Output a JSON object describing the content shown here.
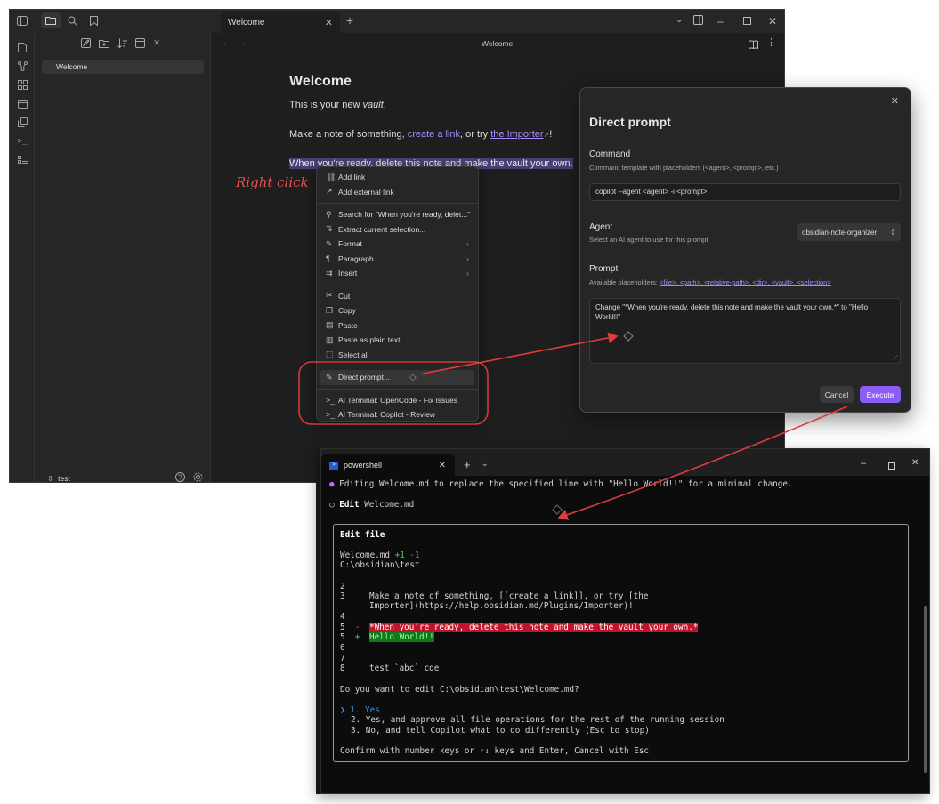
{
  "obsidian": {
    "tab_title": "Welcome",
    "view_title": "Welcome",
    "sidebar_file": "Welcome",
    "vault_name": "test",
    "note": {
      "heading": "Welcome",
      "line1_pre": "This is your new ",
      "line1_em": "vault",
      "line1_post": ".",
      "line2_pre": "Make a note of something, ",
      "line2_link1": "create a link",
      "line2_mid": ", or try ",
      "line2_link2": "the Importer",
      "line2_post": "!",
      "line3_selected": "When you're ready, delete this note and make the vault your own."
    }
  },
  "annotation": {
    "right_click": "Right click"
  },
  "context_menu": {
    "group1": [
      {
        "icon": "link-icon",
        "label": "Add link"
      },
      {
        "icon": "external-link-icon",
        "label": "Add external link"
      }
    ],
    "group2": [
      {
        "icon": "search-icon",
        "label": "Search for \"When you're ready, delet...\""
      },
      {
        "icon": "extract-icon",
        "label": "Extract current selection..."
      },
      {
        "icon": "format-icon",
        "label": "Format"
      },
      {
        "icon": "paragraph-icon",
        "label": "Paragraph"
      },
      {
        "icon": "insert-icon",
        "label": "Insert"
      }
    ],
    "group3": [
      {
        "icon": "cut-icon",
        "label": "Cut"
      },
      {
        "icon": "copy-icon",
        "label": "Copy"
      },
      {
        "icon": "paste-icon",
        "label": "Paste"
      },
      {
        "icon": "paste-plain-icon",
        "label": "Paste as plain text"
      },
      {
        "icon": "select-all-icon",
        "label": "Select all"
      }
    ],
    "group4": [
      {
        "icon": "edit-icon",
        "label": "Direct prompt..."
      }
    ],
    "group5": [
      {
        "icon": "terminal-icon",
        "label": "AI Terminal: OpenCode - Fix Issues"
      },
      {
        "icon": "terminal-icon",
        "label": "AI Terminal: Copilot - Review"
      }
    ]
  },
  "modal": {
    "title": "Direct prompt",
    "command_label": "Command",
    "command_desc": "Command template with placeholders (<agent>, <prompt>, etc.)",
    "command_value": "copilot --agent <agent> -i <prompt>",
    "agent_label": "Agent",
    "agent_desc": "Select an AI agent to use for this prompt",
    "agent_value": "obsidian-note-organizer",
    "prompt_label": "Prompt",
    "prompt_desc_prefix": "Available placeholders: ",
    "placeholders": "<file>, <path>, <relative-path>, <dir>, <vault>, <selection>",
    "prompt_value": "Change \"*When you're ready, delete this note and make the vault your own.*\" to \"Hello World!!\"",
    "cancel_label": "Cancel",
    "execute_label": "Execute"
  },
  "terminal": {
    "tab_title": "powershell",
    "line1": "Editing Welcome.md to replace the specified line with \"Hello World!!\" for a minimal change.",
    "line2_bold": "Edit",
    "line2_rest": " Welcome.md",
    "edit_box": {
      "title": "Edit file",
      "file": "Welcome.md",
      "plus": "+1",
      "minus": "-1",
      "path": "C:\\obsidian\\test",
      "lines": [
        {
          "num": "2",
          "mark": "",
          "text": ""
        },
        {
          "num": "3",
          "mark": "",
          "text": "Make a note of something, [[create a link]], or try [the"
        },
        {
          "num": "",
          "mark": "",
          "text": "Importer](https://help.obsidian.md/Plugins/Importer)!"
        },
        {
          "num": "4",
          "mark": "",
          "text": ""
        },
        {
          "num": "5",
          "mark": "-",
          "text": "*When you're ready, delete this note and make the vault your own.*"
        },
        {
          "num": "5",
          "mark": "+",
          "text": "Hello World!!"
        },
        {
          "num": "6",
          "mark": "",
          "text": ""
        },
        {
          "num": "7",
          "mark": "",
          "text": ""
        },
        {
          "num": "8",
          "mark": "",
          "text": "test `abc` cde"
        }
      ],
      "question": "Do you want to edit C:\\obsidian\\test\\Welcome.md?",
      "option1": "1. Yes",
      "option2": "2. Yes, and approve all file operations for the rest of the running session",
      "option3": "3. No, and tell Copilot what to do differently (Esc to stop)",
      "footer": "Confirm with number keys or ↑↓ keys and Enter, Cancel with Esc"
    }
  },
  "colors": {
    "accent": "#8b5cf6",
    "annotation_red": "#e03c3c"
  }
}
